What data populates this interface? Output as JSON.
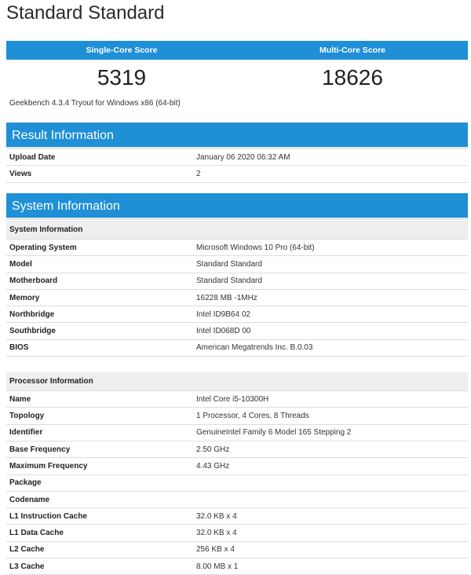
{
  "title": "Standard Standard",
  "scores": {
    "single_label": "Single-Core Score",
    "multi_label": "Multi-Core Score",
    "single_value": "5319",
    "multi_value": "18626"
  },
  "version": "Geekbench 4.3.4 Tryout for Windows x86 (64-bit)",
  "result_info": {
    "header": "Result Information",
    "rows": [
      {
        "key": "Upload Date",
        "value": "January 06 2020 06:32 AM"
      },
      {
        "key": "Views",
        "value": "2"
      }
    ]
  },
  "system_info": {
    "header": "System Information",
    "sys_subheader": "System Information",
    "sys_rows": [
      {
        "key": "Operating System",
        "value": "Microsoft Windows 10 Pro (64-bit)"
      },
      {
        "key": "Model",
        "value": "Standard Standard"
      },
      {
        "key": "Motherboard",
        "value": "Standard Standard"
      },
      {
        "key": "Memory",
        "value": "16228 MB -1MHz"
      },
      {
        "key": "Northbridge",
        "value": "Intel ID9B64 02"
      },
      {
        "key": "Southbridge",
        "value": "Intel ID068D 00"
      },
      {
        "key": "BIOS",
        "value": "American Megatrends Inc. B.0.03"
      }
    ],
    "proc_subheader": "Processor Information",
    "proc_rows": [
      {
        "key": "Name",
        "value": "Intel Core i5-10300H"
      },
      {
        "key": "Topology",
        "value": "1 Processor, 4 Cores, 8 Threads"
      },
      {
        "key": "Identifier",
        "value": "GenuineIntel Family 6 Model 165 Stepping 2"
      },
      {
        "key": "Base Frequency",
        "value": "2.50 GHz"
      },
      {
        "key": "Maximum Frequency",
        "value": "4.43 GHz"
      },
      {
        "key": "Package",
        "value": ""
      },
      {
        "key": "Codename",
        "value": ""
      },
      {
        "key": "L1 Instruction Cache",
        "value": "32.0 KB x 4"
      },
      {
        "key": "L1 Data Cache",
        "value": "32.0 KB x 4"
      },
      {
        "key": "L2 Cache",
        "value": "256 KB x 4"
      },
      {
        "key": "L3 Cache",
        "value": "8.00 MB x 1"
      }
    ]
  }
}
